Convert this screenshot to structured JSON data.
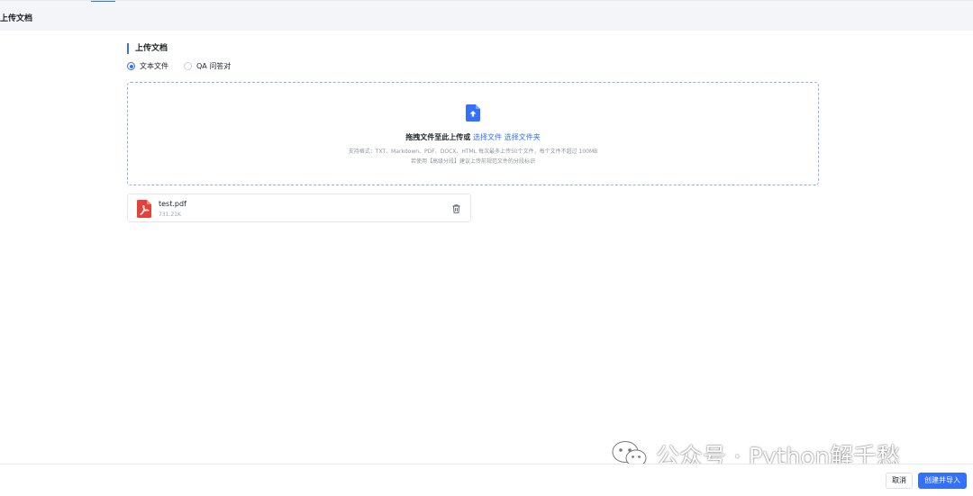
{
  "header": {
    "title": "上传文档"
  },
  "section": {
    "title": "上传文档"
  },
  "file_type": {
    "options": [
      {
        "label": "文本文件",
        "checked": true
      },
      {
        "label": "QA 问答对",
        "checked": false
      }
    ]
  },
  "dropzone": {
    "prompt": "拖拽文件至此上传或",
    "select_file": "选择文件",
    "select_folder": "选择文件夹",
    "hint_formats": "支持格式：TXT、Markdown、PDF、DOCX、HTML 每次最多上传50个文件，每个文件不超过 100MB",
    "hint_split": "若使用【高级分段】建议上传前规范文件的分段标识",
    "icon": "file-upload-icon"
  },
  "files": [
    {
      "name": "test.pdf",
      "size": "731.21K",
      "icon": "pdf-icon"
    }
  ],
  "footer": {
    "cancel_label": "取消",
    "submit_label": "创建并导入"
  },
  "watermark": {
    "text": "公众号 · Python解千愁",
    "icon": "wechat-icon"
  },
  "colors": {
    "accent": "#3370ff",
    "pdf": "#e5413b",
    "background": "#f4f5f8"
  }
}
